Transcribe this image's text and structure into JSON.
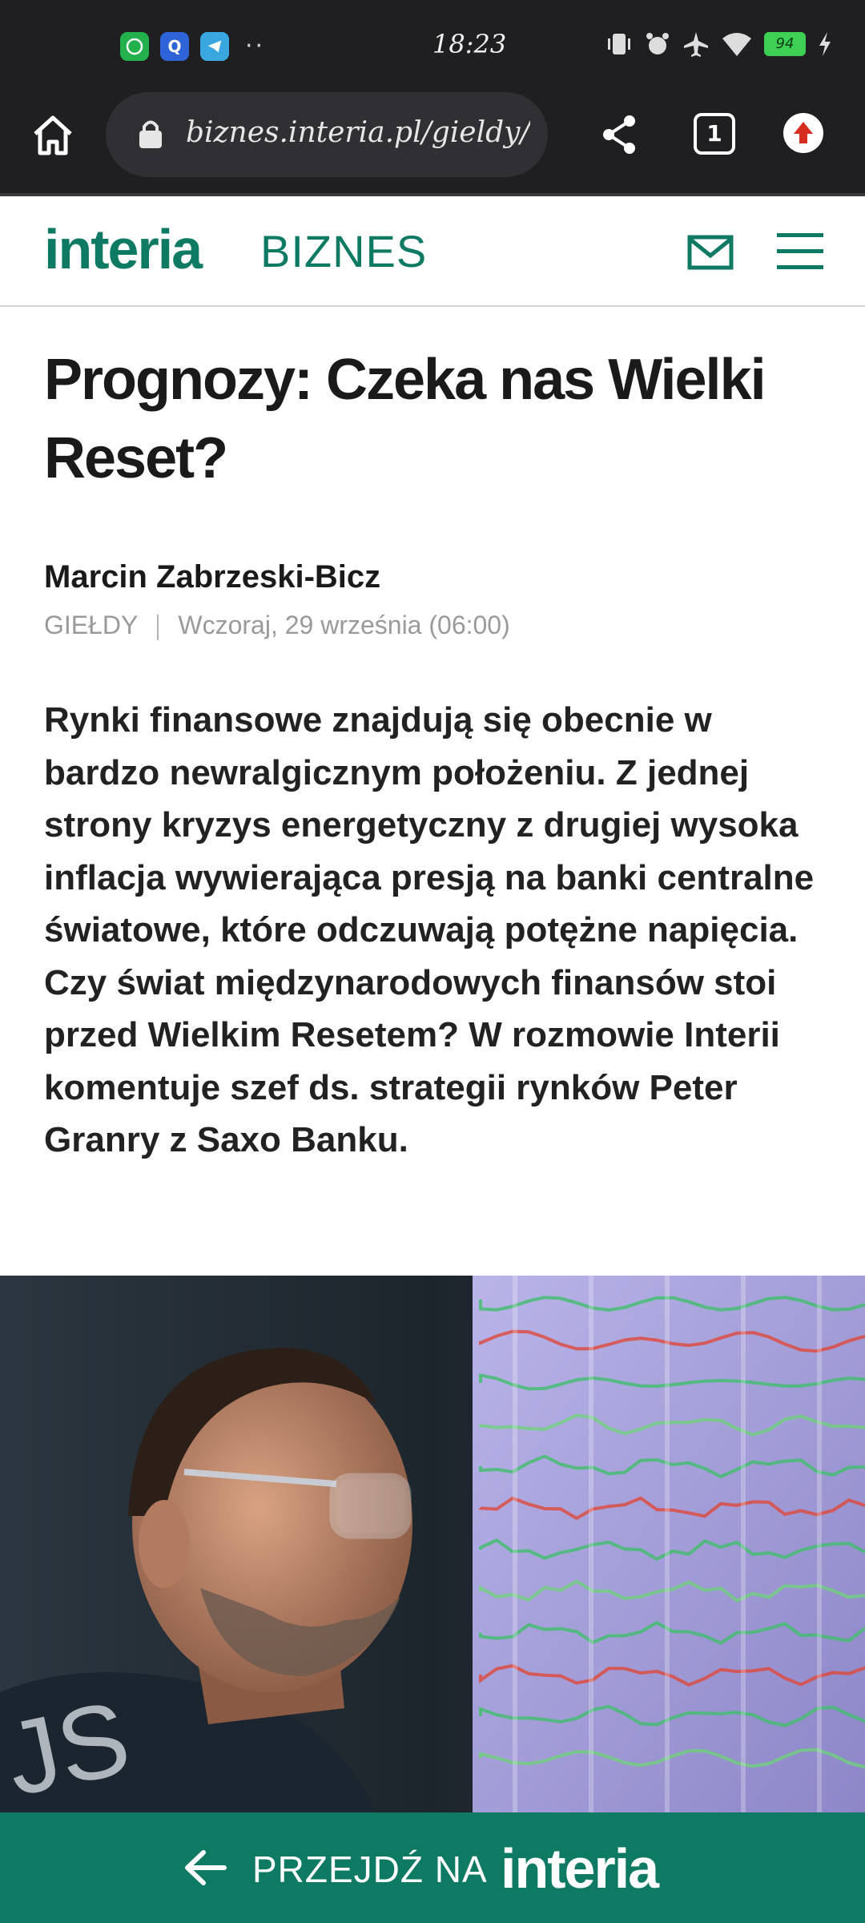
{
  "status_bar": {
    "time": "18:23",
    "app_q": "Q",
    "dots": "··",
    "battery": "94"
  },
  "browser": {
    "url": "biznes.interia.pl/gieldy/a",
    "tab_count": "1"
  },
  "site_header": {
    "logo": "interia",
    "section": "BIZNES"
  },
  "article": {
    "title": "Prognozy: Czeka nas Wielki Reset?",
    "author": "Marcin Zabrzeski-Bicz",
    "category": "GIEŁDY",
    "date": "Wczoraj, 29 września (06:00)",
    "lead": "Rynki finansowe znajdują się obecnie w bardzo newralgicznym położeniu. Z jednej strony kryzys energetyczny z drugiej wysoka inflacja wywierająca presją na banki centralne światowe, które odczuwają potężne napięcia. Czy świat międzynarodowych finansów stoi przed Wielkim Resetem? W rozmowie Interii komentuje szef ds. strategii rynków Peter Granry z Saxo Banku."
  },
  "bottom_bar": {
    "label": "PRZEJDŹ NA",
    "logo": "interia"
  },
  "colors": {
    "brand": "#0f7a63",
    "chrome": "#1f1f21"
  }
}
